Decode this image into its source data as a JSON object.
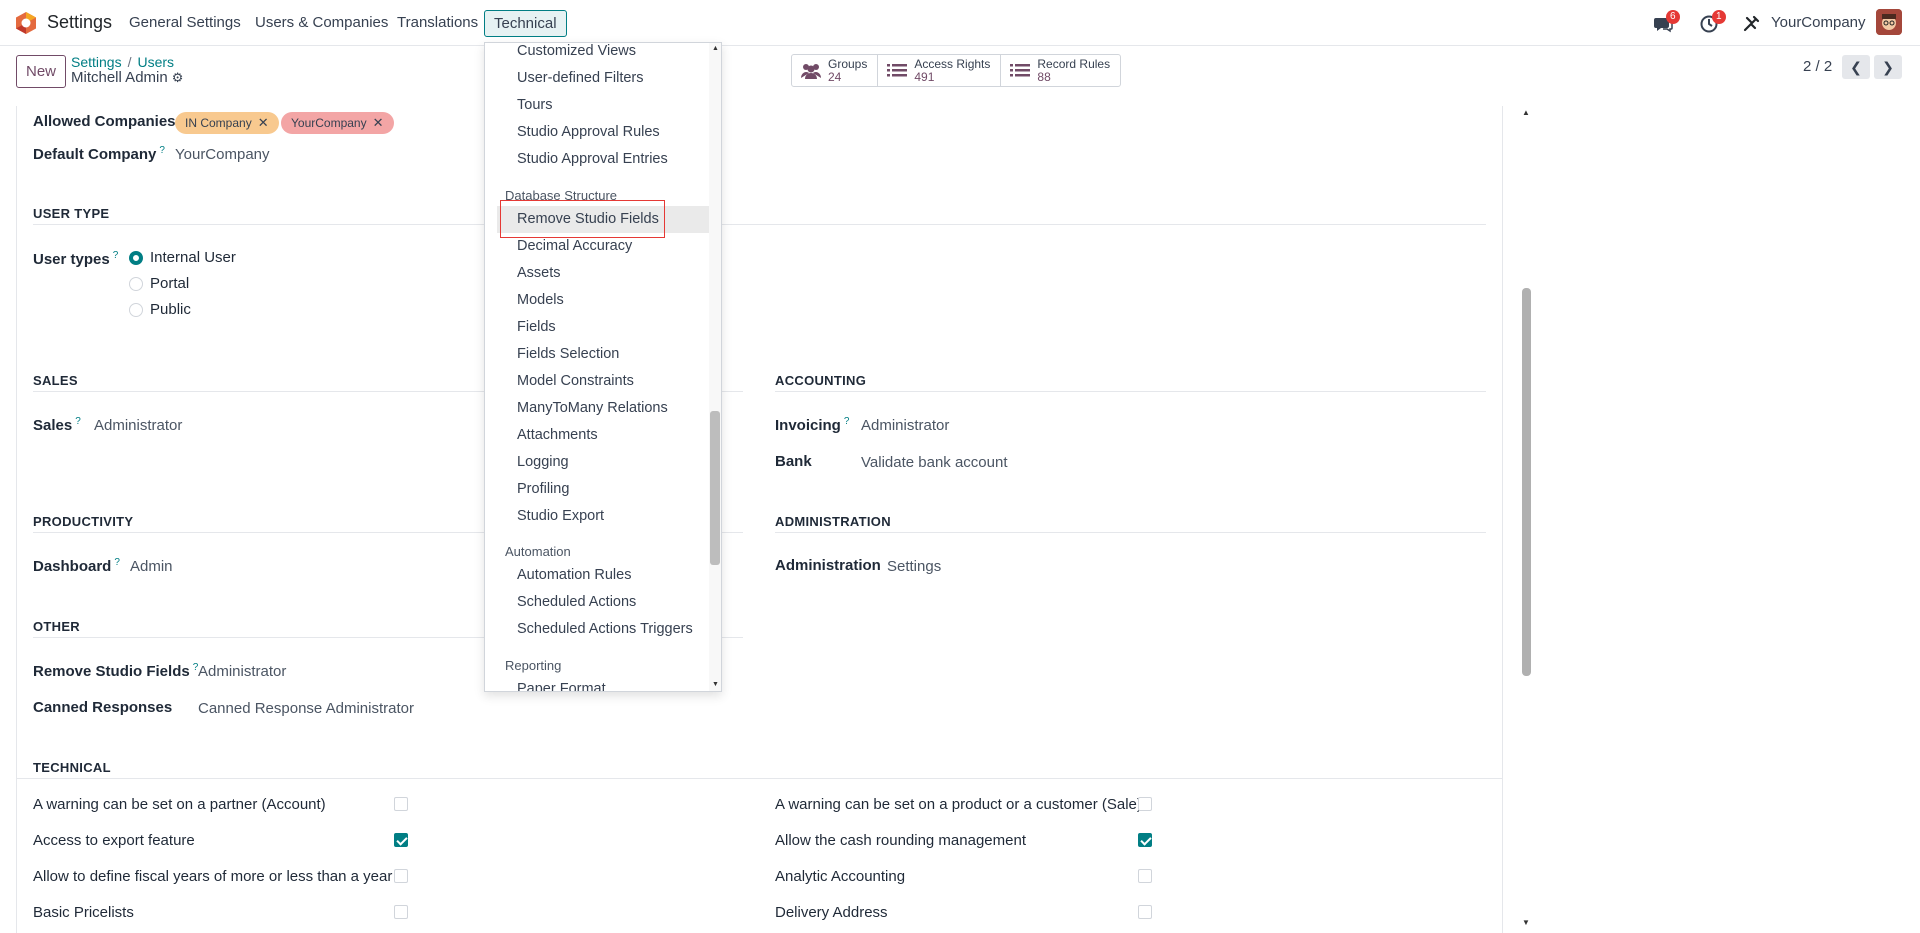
{
  "navbar": {
    "app_name": "Settings",
    "menu": [
      "General Settings",
      "Users & Companies",
      "Translations",
      "Technical"
    ],
    "messages_count": "6",
    "activities_count": "1",
    "company": "YourCompany"
  },
  "control_panel": {
    "new_label": "New",
    "breadcrumb": [
      "Settings",
      "Users"
    ],
    "record_title": "Mitchell Admin",
    "stats": [
      {
        "label": "Groups",
        "value": "24"
      },
      {
        "label": "Access Rights",
        "value": "491"
      },
      {
        "label": "Record Rules",
        "value": "88"
      }
    ],
    "pager": "2 / 2"
  },
  "form": {
    "allowed_companies_label": "Allowed Companies",
    "allowed_companies": [
      "IN Company",
      "YourCompany"
    ],
    "default_company_label": "Default Company",
    "default_company": "YourCompany",
    "user_type_section": "USER TYPE",
    "user_types_label": "User types",
    "user_types": [
      "Internal User",
      "Portal",
      "Public"
    ],
    "user_type_selected": "Internal User",
    "sales_section": "SALES",
    "sales_label": "Sales",
    "sales_value": "Administrator",
    "accounting_section": "ACCOUNTING",
    "invoicing_label": "Invoicing",
    "invoicing_value": "Administrator",
    "bank_label": "Bank",
    "bank_value": "Validate bank account",
    "productivity_section": "PRODUCTIVITY",
    "dashboard_label": "Dashboard",
    "dashboard_value": "Admin",
    "administration_section": "ADMINISTRATION",
    "administration_label": "Administration",
    "administration_value": "Settings",
    "other_section": "OTHER",
    "remove_studio_label": "Remove Studio Fields",
    "remove_studio_value": "Administrator",
    "canned_label": "Canned Responses",
    "canned_value": "Canned Response Administrator",
    "technical_section": "TECHNICAL",
    "technical_left": [
      {
        "label": "A warning can be set on a partner (Account)",
        "checked": false
      },
      {
        "label": "Access to export feature",
        "checked": true
      },
      {
        "label": "Allow to define fiscal years of more or less than a year",
        "checked": false
      },
      {
        "label": "Basic Pricelists",
        "checked": false
      }
    ],
    "technical_right": [
      {
        "label": "A warning can be set on a product or a customer (Sale)",
        "checked": false
      },
      {
        "label": "Allow the cash rounding management",
        "checked": true
      },
      {
        "label": "Analytic Accounting",
        "checked": false
      },
      {
        "label": "Delivery Address",
        "checked": false
      }
    ]
  },
  "technical_menu": {
    "items_top": [
      "Customized Views",
      "User-defined Filters",
      "Tours",
      "Studio Approval Rules",
      "Studio Approval Entries"
    ],
    "db_header": "Database Structure",
    "db_items": [
      "Remove Studio Fields",
      "Decimal Accuracy",
      "Assets",
      "Models",
      "Fields",
      "Fields Selection",
      "Model Constraints",
      "ManyToMany Relations",
      "Attachments",
      "Logging",
      "Profiling",
      "Studio Export"
    ],
    "automation_header": "Automation",
    "automation_items": [
      "Automation Rules",
      "Scheduled Actions",
      "Scheduled Actions Triggers"
    ],
    "reporting_header": "Reporting",
    "reporting_items": [
      "Paper Format"
    ],
    "highlighted": "Remove Studio Fields"
  },
  "colors": {
    "brand": "#714b67",
    "accent": "#017e84",
    "highlight_box": "#e53935",
    "tag_in_company": "#f8c98f",
    "tag_yourcompany": "#f3a5a5"
  }
}
